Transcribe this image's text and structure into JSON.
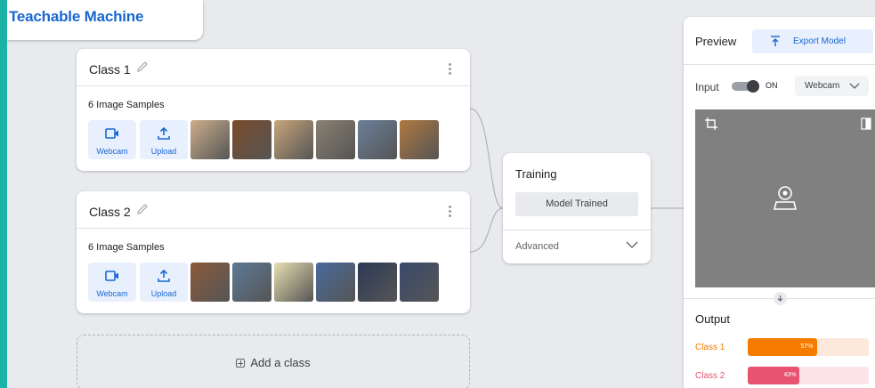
{
  "app": {
    "title": "Teachable Machine"
  },
  "classes": [
    {
      "name": "Class 1",
      "samples_label": "6 Image Samples",
      "webcam_label": "Webcam",
      "upload_label": "Upload",
      "thumb_colors": [
        "#cdae8c",
        "#7a4b2a",
        "#c7a57a",
        "#8a8070",
        "#6b7f99",
        "#b07840"
      ]
    },
    {
      "name": "Class 2",
      "samples_label": "6 Image Samples",
      "webcam_label": "Webcam",
      "upload_label": "Upload",
      "thumb_colors": [
        "#8b5a3c",
        "#5c7a95",
        "#e8dfb0",
        "#4a6b9c",
        "#2c3a55",
        "#3a4a6b"
      ]
    }
  ],
  "add_class": {
    "label": "Add a class"
  },
  "training": {
    "title": "Training",
    "status_button": "Model Trained",
    "advanced_label": "Advanced"
  },
  "preview": {
    "title": "Preview",
    "export_label": "Export Model",
    "input_label": "Input",
    "toggle_label": "ON",
    "toggle_on": true,
    "source_select": "Webcam",
    "output_label": "Output",
    "outputs": [
      {
        "label": "Class 1",
        "percent": 57,
        "percent_text": "57%",
        "color": "#f57c00",
        "track_color": "#fde9dc"
      },
      {
        "label": "Class 2",
        "percent": 43,
        "percent_text": "43%",
        "color": "#e8546f",
        "track_color": "#fce4ea"
      }
    ]
  },
  "colors": {
    "accent_blue": "#1967d2",
    "background": "#e8eaed",
    "frame": "#1bb3a6",
    "camera_view": "#808080"
  }
}
